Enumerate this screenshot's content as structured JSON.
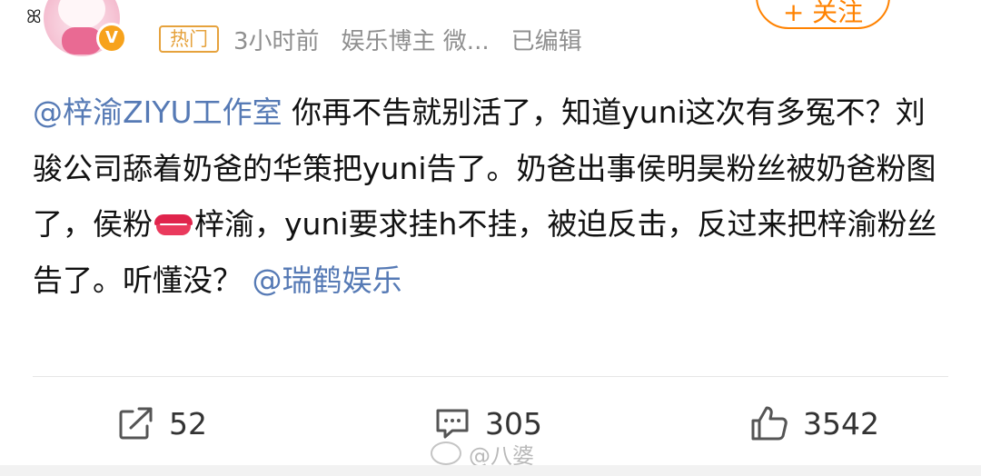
{
  "header": {
    "tag": "热门",
    "time": "3小时前",
    "source": "娱乐博主 微...",
    "edited": "已编辑",
    "follow_label": "+ 关注",
    "verified_badge": "V",
    "pin_icon": "ribbon-pin-icon"
  },
  "post": {
    "mention_1": "@梓渝ZIYU工作室",
    "text_1": " 你再不告就别活了，知道yuni这次有多冤不？刘骏公司舔着奶爸的华策把yuni告了。奶爸出事侯明昊粉丝被奶爸粉图了，侯粉",
    "emoji": "lips-icon",
    "text_2": "梓渝，yuni要求挂h不挂，被迫反击，反过来把梓渝粉丝告了。听懂没？ ",
    "mention_2": "@瑞鹤娱乐"
  },
  "actions": {
    "repost_count": "52",
    "comment_count": "305",
    "like_count": "3542"
  },
  "watermark": {
    "text": "@八婆"
  },
  "colors": {
    "mention": "#567ab5",
    "hot_tag": "#e6a23c",
    "follow": "#ff8200",
    "meta": "#8f8f8f"
  }
}
